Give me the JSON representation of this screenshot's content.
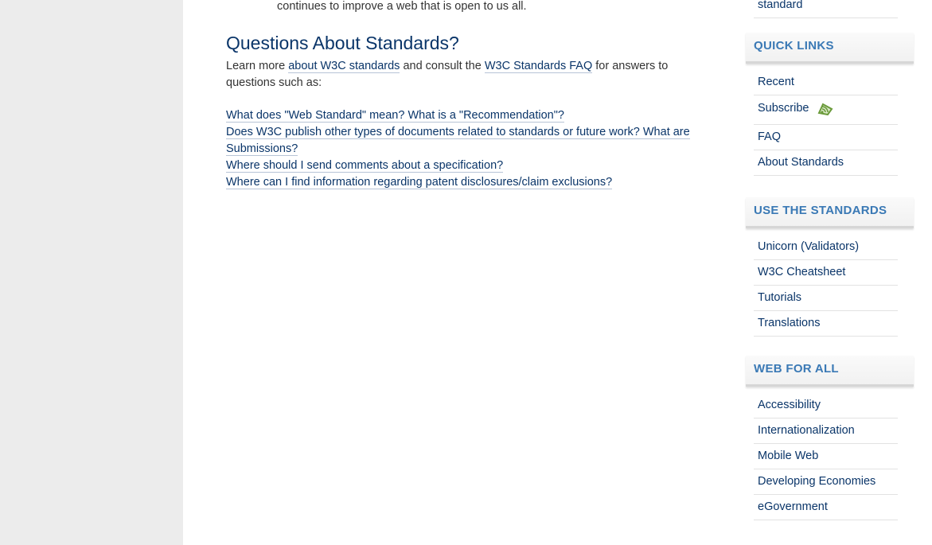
{
  "main": {
    "top_fragment": "continues to improve a web that is open to us all.",
    "heading": "Questions About Standards?",
    "intro": {
      "text_1": "Learn more ",
      "link_1": "about W3C standards",
      "text_2": " and consult the ",
      "link_2": "W3C Standards FAQ",
      "text_3": " for answers to questions such as:"
    },
    "questions": [
      "What does \"Web Standard\" mean? What is a \"Recommendation\"?",
      "Does W3C publish other types of documents related to standards or future work? What are Submissions?",
      "Where should I send comments about a specification?",
      "Where can I find information regarding patent disclosures/claim exclusions?"
    ]
  },
  "sidebar": {
    "top_fragment": "standard",
    "quick_links": {
      "title": "QUICK LINKS",
      "items": [
        "Recent",
        "Subscribe",
        "FAQ",
        "About Standards"
      ]
    },
    "use_the_standards": {
      "title": "USE THE STANDARDS",
      "items": [
        "Unicorn (Validators)",
        "W3C Cheatsheet",
        "Tutorials",
        "Translations"
      ]
    },
    "web_for_all": {
      "title": "WEB FOR ALL",
      "items": [
        "Accessibility",
        "Internationalization",
        "Mobile Web",
        "Developing Economies",
        "eGovernment"
      ]
    }
  },
  "icons": {
    "subscribe": "rss-feed-icon"
  },
  "colors": {
    "heading": "#0a3569",
    "link": "#0a3569",
    "sidebar_heading": "#3a79b5",
    "gutter": "#ececec",
    "rss_icon": "#6a9a3a"
  }
}
